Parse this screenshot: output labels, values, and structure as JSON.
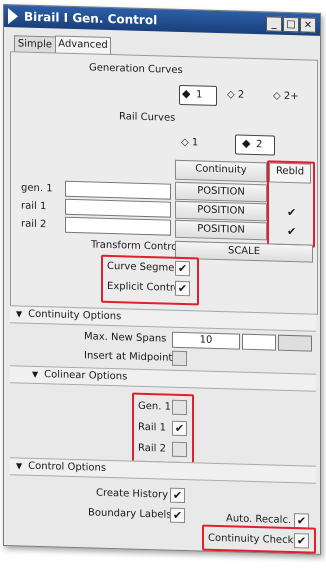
{
  "window": {
    "title": "Birail I Gen. Control",
    "min_label": "_",
    "max_label": "□",
    "close_label": "×"
  },
  "tabs": [
    {
      "label": "Simple",
      "active": false
    },
    {
      "label": "Advanced",
      "active": true
    }
  ],
  "generation_curves": {
    "label": "Generation Curves",
    "options": [
      "1",
      "2",
      "2+"
    ],
    "selected": "1"
  },
  "rail_curves": {
    "label": "Rail Curves",
    "options": [
      "1",
      "2"
    ],
    "selected": "2"
  },
  "continuity_table": {
    "col_continuity": "Continuity",
    "col_rebld": "Rebld",
    "rows": [
      {
        "label": "gen. 1",
        "continuity": "POSITION",
        "rebld": ""
      },
      {
        "label": "rail 1",
        "continuity": "POSITION",
        "rebld": "✔"
      },
      {
        "label": "rail 2",
        "continuity": "POSITION",
        "rebld": "✔"
      }
    ]
  },
  "transform_control": {
    "label": "Transform Control",
    "value": "SCALE"
  },
  "curve_segments": {
    "label": "Curve Segments",
    "checked": "✔"
  },
  "explicit_control": {
    "label": "Explicit Contro",
    "checked": "✔"
  },
  "continuity_options": {
    "header": "Continuity Options",
    "max_new_spans_label": "Max. New Spans",
    "max_new_spans_value": "10",
    "insert_midpoint_label": "Insert at Midpoint"
  },
  "colinear_options": {
    "header": "Colinear Options",
    "items": [
      {
        "label": "Gen. 1",
        "checked": ""
      },
      {
        "label": "Rail 1",
        "checked": "✔"
      },
      {
        "label": "Rail 2",
        "checked": ""
      }
    ]
  },
  "control_options": {
    "header": "Control Options",
    "create_history_label": "Create History",
    "create_history_checked": "✔",
    "boundary_labels_label": "Boundary Labels",
    "boundary_labels_checked": "✔",
    "auto_recalc_label": "Auto. Recalc.",
    "auto_recalc_checked": "✔",
    "continuity_check_label": "Continuity Check",
    "continuity_check_checked": "✔"
  },
  "colors": {
    "titlebar": "#1a3f7a",
    "highlight": "#e0212b"
  }
}
